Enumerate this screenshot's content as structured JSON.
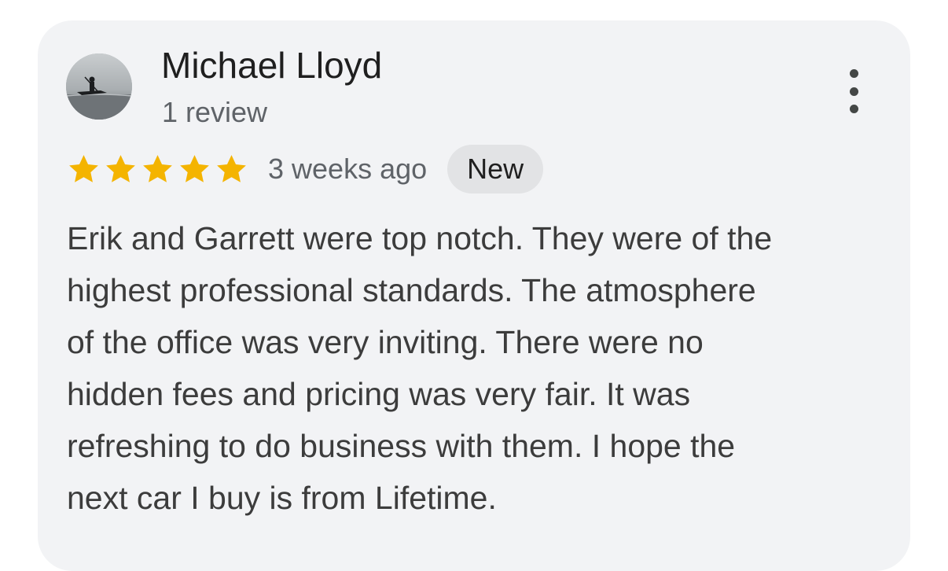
{
  "review": {
    "author_name": "Michael Lloyd",
    "review_count": "1 review",
    "avatar_icon": "kayak-photo-avatar",
    "more_icon": "more-vert-icon",
    "rating": 5,
    "rating_max": 5,
    "star_color": "#f4b400",
    "time_ago": "3 weeks ago",
    "badge": "New",
    "text_lines": [
      "Erik and Garrett were top notch. They were of the",
      "highest professional standards. The atmosphere",
      "of the office was very inviting. There were no",
      "hidden fees and pricing was very fair. It was",
      "refreshing to do business with them. I hope the",
      "next car I buy is from Lifetime."
    ]
  }
}
